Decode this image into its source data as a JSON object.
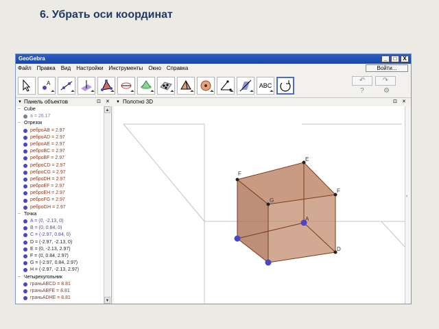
{
  "slide": {
    "title": "6. Убрать оси координат"
  },
  "window": {
    "title": "GeoGebra",
    "minimize": "_",
    "maximize": "□",
    "close": "X",
    "signin": "Войти..."
  },
  "menu": [
    "Файл",
    "Правка",
    "Вид",
    "Настройки",
    "Инструменты",
    "Окно",
    "Справка"
  ],
  "toolbar": {
    "tools": [
      {
        "name": "move-tool",
        "icon": "cursor-arrow-icon"
      },
      {
        "name": "point-tool",
        "icon": "point-icon",
        "label": "A"
      },
      {
        "name": "line-tool",
        "icon": "line-icon"
      },
      {
        "name": "perpendicular-tool",
        "icon": "perpendicular-plane-icon"
      },
      {
        "name": "polygon-tool",
        "icon": "triangle-icon"
      },
      {
        "name": "circle-tool",
        "icon": "circle-axis-icon"
      },
      {
        "name": "intersect-surfaces-tool",
        "icon": "surface-intersect-icon"
      },
      {
        "name": "plane-tool",
        "icon": "plane-points-icon"
      },
      {
        "name": "pyramid-tool",
        "icon": "pyramid-icon"
      },
      {
        "name": "sphere-tool",
        "icon": "sphere-icon"
      },
      {
        "name": "angle-tool",
        "icon": "angle-icon"
      },
      {
        "name": "reflect-tool",
        "icon": "reflect-plane-icon"
      },
      {
        "name": "text-tool",
        "icon": "text-icon",
        "label": "ABC"
      },
      {
        "name": "rotate-view-tool",
        "icon": "rotate-view-icon"
      }
    ],
    "undo": "↶",
    "redo": "↷",
    "help": "?",
    "settings": "⚙"
  },
  "panels": {
    "algebra_title": "Панель объектов",
    "graphics_title": "Полотно 3D"
  },
  "algebra": {
    "groups": [
      {
        "label": "Cube",
        "items": [
          {
            "text": "a = 26.17",
            "color": "#7c7c99"
          }
        ]
      },
      {
        "label": "Отрезок",
        "items": [
          {
            "text": "реброAB = 2.97",
            "color": "#8b3a1a"
          },
          {
            "text": "реброAD = 2.97",
            "color": "#8b3a1a"
          },
          {
            "text": "реброAE = 2.97",
            "color": "#8b3a1a"
          },
          {
            "text": "реброBC = 2.97",
            "color": "#8b3a1a"
          },
          {
            "text": "реброBF = 2.97",
            "color": "#8b3a1a"
          },
          {
            "text": "реброCD = 2.97",
            "color": "#8b3a1a"
          },
          {
            "text": "реброCG = 2.97",
            "color": "#8b3a1a"
          },
          {
            "text": "реброDH = 2.97",
            "color": "#8b3a1a"
          },
          {
            "text": "реброEF = 2.97",
            "color": "#8b3a1a"
          },
          {
            "text": "реброEH = 2.97",
            "color": "#8b3a1a"
          },
          {
            "text": "реброFG = 2.97",
            "color": "#8b3a1a"
          },
          {
            "text": "реброGH = 2.97",
            "color": "#8b3a1a"
          }
        ]
      },
      {
        "label": "Точка",
        "items": [
          {
            "text": "A = (0, -2.13, 0)",
            "color": "#4a46c8"
          },
          {
            "text": "B = (0, 0.84, 0)",
            "color": "#4a46c8"
          },
          {
            "text": "C = (-2.97, 0.84, 0)",
            "color": "#4a46c8"
          },
          {
            "text": "D = (-2.97, -2.13, 0)",
            "color": "#222222"
          },
          {
            "text": "E = (0, -2.13, 2.97)",
            "color": "#222222"
          },
          {
            "text": "F = (0, 0.84, 2.97)",
            "color": "#222222"
          },
          {
            "text": "G = (-2.97, 0.84, 2.97)",
            "color": "#222222"
          },
          {
            "text": "H = (-2.97, -2.13, 2.97)",
            "color": "#222222"
          }
        ]
      },
      {
        "label": "Четырехугольник",
        "items": [
          {
            "text": "граньABCD = 8.81",
            "color": "#8b3a1a"
          },
          {
            "text": "граньABFE = 8.81",
            "color": "#8b3a1a"
          },
          {
            "text": "граньADHE = 8.81",
            "color": "#8b3a1a"
          }
        ]
      }
    ]
  },
  "graphics": {
    "point_labels": [
      "E",
      "F",
      "F",
      "G",
      "A",
      "D"
    ],
    "colors": {
      "face": "#b87a5a",
      "edge": "#7a3a1a",
      "vertex": "#4a46c8",
      "box": "#c4c4c4"
    }
  }
}
